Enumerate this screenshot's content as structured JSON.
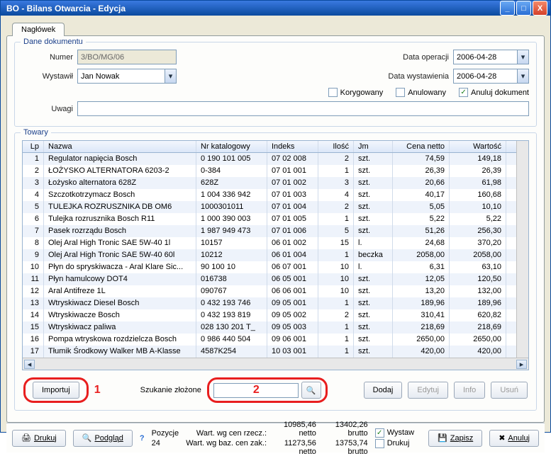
{
  "window": {
    "title": "BO - Bilans Otwarcia - Edycja"
  },
  "tab": {
    "label": "Nagłówek"
  },
  "doc": {
    "legend": "Dane dokumentu",
    "numer_label": "Numer",
    "numer": "3/BO/MG/06",
    "wystawil_label": "Wystawił",
    "wystawil": "Jan Nowak",
    "uwagi_label": "Uwagi",
    "uwagi": "",
    "data_op_label": "Data operacji",
    "data_op": "2006-04-28",
    "data_wys_label": "Data wystawienia",
    "data_wys": "2006-04-28",
    "korygowany": "Korygowany",
    "anulowany": "Anulowany",
    "anuluj_dok": "Anuluj dokument"
  },
  "goods": {
    "legend": "Towary",
    "headers": {
      "lp": "Lp",
      "nazwa": "Nazwa",
      "kat": "Nr katalogowy",
      "idx": "Indeks",
      "ilosc": "Ilość",
      "jm": "Jm",
      "cena": "Cena netto",
      "wart": "Wartość"
    },
    "rows": [
      {
        "lp": "1",
        "nm": "Regulator napięcia Bosch",
        "kat": "0 190 101 005",
        "idx": "07 02 008",
        "il": "2",
        "jm": "szt.",
        "cn": "74,59",
        "wr": "149,18"
      },
      {
        "lp": "2",
        "nm": "ŁOŻYSKO ALTERNATORA 6203-2",
        "kat": "0-384",
        "idx": "07 01 001",
        "il": "1",
        "jm": "szt.",
        "cn": "26,39",
        "wr": "26,39"
      },
      {
        "lp": "3",
        "nm": "Łożysko alternatora 628Z",
        "kat": "628Z",
        "idx": "07 01 002",
        "il": "3",
        "jm": "szt.",
        "cn": "20,66",
        "wr": "61,98"
      },
      {
        "lp": "4",
        "nm": "Szczotkotrzymacz Bosch",
        "kat": "1 004 336 942",
        "idx": "07 01 003",
        "il": "4",
        "jm": "szt.",
        "cn": "40,17",
        "wr": "160,68"
      },
      {
        "lp": "5",
        "nm": "TULEJKA ROZRUSZNIKA DB OM6",
        "kat": "1000301011",
        "idx": "07 01 004",
        "il": "2",
        "jm": "szt.",
        "cn": "5,05",
        "wr": "10,10"
      },
      {
        "lp": "6",
        "nm": "Tulejka rozrusznika Bosch R11",
        "kat": "1 000 390 003",
        "idx": "07 01 005",
        "il": "1",
        "jm": "szt.",
        "cn": "5,22",
        "wr": "5,22"
      },
      {
        "lp": "7",
        "nm": "Pasek rozrządu Bosch",
        "kat": "1 987 949 473",
        "idx": "07 01 006",
        "il": "5",
        "jm": "szt.",
        "cn": "51,26",
        "wr": "256,30"
      },
      {
        "lp": "8",
        "nm": "Olej Aral High Tronic SAE 5W-40 1l",
        "kat": "10157",
        "idx": "06 01 002",
        "il": "15",
        "jm": "l.",
        "cn": "24,68",
        "wr": "370,20"
      },
      {
        "lp": "9",
        "nm": "Olej Aral High Tronic SAE 5W-40 60l",
        "kat": "10212",
        "idx": "06 01 004",
        "il": "1",
        "jm": "beczka",
        "cn": "2058,00",
        "wr": "2058,00"
      },
      {
        "lp": "10",
        "nm": "Płyn do spryskiwacza - Aral Klare Sic...",
        "kat": "90 100 10",
        "idx": "06 07 001",
        "il": "10",
        "jm": "l.",
        "cn": "6,31",
        "wr": "63,10"
      },
      {
        "lp": "11",
        "nm": "Płyn hamulcowy DOT4",
        "kat": "016738",
        "idx": "06 05 001",
        "il": "10",
        "jm": "szt.",
        "cn": "12,05",
        "wr": "120,50"
      },
      {
        "lp": "12",
        "nm": "Aral Antifreze 1L",
        "kat": "090767",
        "idx": "06 06 001",
        "il": "10",
        "jm": "szt.",
        "cn": "13,20",
        "wr": "132,00"
      },
      {
        "lp": "13",
        "nm": "Wtryskiwacz Diesel Bosch",
        "kat": "0 432 193 746",
        "idx": "09 05 001",
        "il": "1",
        "jm": "szt.",
        "cn": "189,96",
        "wr": "189,96"
      },
      {
        "lp": "14",
        "nm": "Wtryskiwacze Bosch",
        "kat": "0 432 193 819",
        "idx": "09 05 002",
        "il": "2",
        "jm": "szt.",
        "cn": "310,41",
        "wr": "620,82"
      },
      {
        "lp": "15",
        "nm": "Wtryskiwacz paliwa",
        "kat": "028 130 201 T_",
        "idx": "09 05 003",
        "il": "1",
        "jm": "szt.",
        "cn": "218,69",
        "wr": "218,69"
      },
      {
        "lp": "16",
        "nm": "Pompa wtryskowa rozdzielcza Bosch",
        "kat": "0 986 440 504",
        "idx": "09 06 001",
        "il": "1",
        "jm": "szt.",
        "cn": "2650,00",
        "wr": "2650,00"
      },
      {
        "lp": "17",
        "nm": "Tłumik Środkowy Walker MB A-Klasse",
        "kat": "4587K254",
        "idx": "10 03 001",
        "il": "1",
        "jm": "szt.",
        "cn": "420,00",
        "wr": "420,00"
      }
    ]
  },
  "btns": {
    "importuj": "Importuj",
    "szukanie": "Szukanie złożone",
    "dodaj": "Dodaj",
    "edytuj": "Edytuj",
    "info": "Info",
    "usun": "Usuń"
  },
  "annot": {
    "one": "1",
    "two": "2"
  },
  "footer": {
    "drukuj": "Drukuj",
    "podglad": "Podgląd",
    "pozycje_l": "Pozycje",
    "pozycje_v": "24",
    "wart_rzecz_l": "Wart. wg cen rzecz.:",
    "wart_rzecz_n": "10985,46 netto",
    "wart_rzecz_b": "13402,26 brutto",
    "wart_baz_l": "Wart. wg baz. cen zak.:",
    "wart_baz_n": "11273,56 netto",
    "wart_baz_b": "13753,74 brutto",
    "wystaw": "Wystaw",
    "drukuj_chk": "Drukuj",
    "zapisz": "Zapisz",
    "anuluj": "Anuluj"
  }
}
